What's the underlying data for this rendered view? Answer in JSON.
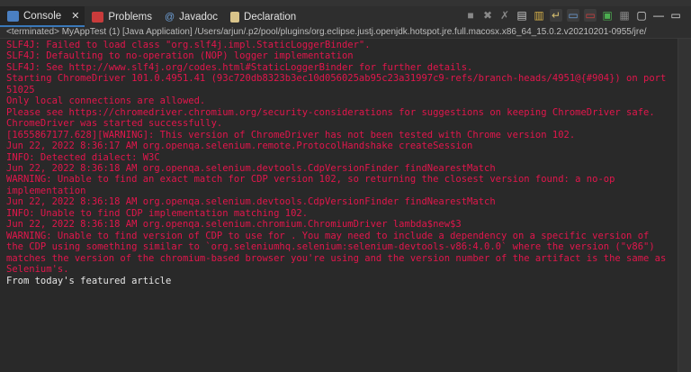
{
  "tabs": [
    {
      "label": "Console",
      "active": true,
      "icon": "console-icon"
    },
    {
      "label": "Problems",
      "icon": "problems-icon"
    },
    {
      "label": "Javadoc",
      "icon": "javadoc-icon"
    },
    {
      "label": "Declaration",
      "icon": "declaration-icon"
    }
  ],
  "toolbar": [
    "terminate-icon",
    "remove-launch-icon",
    "remove-all-icon",
    "clear-console-icon",
    "scroll-lock-icon",
    "word-wrap-icon",
    "show-on-stdout-icon",
    "show-on-stderr-icon",
    "pin-console-icon",
    "display-console-icon",
    "open-console-icon",
    "minimize-icon",
    "maximize-icon"
  ],
  "status": "<terminated> MyAppTest (1) [Java Application] /Users/arjun/.p2/pool/plugins/org.eclipse.justj.openjdk.hotspot.jre.full.macosx.x86_64_15.0.2.v20210201-0955/jre/",
  "colors": {
    "stderr": "#e2164c",
    "stdout": "#e6e6e6",
    "background": "#292929"
  },
  "lines": [
    "SLF4J: Failed to load class \"org.slf4j.impl.StaticLoggerBinder\".",
    "SLF4J: Defaulting to no-operation (NOP) logger implementation",
    "SLF4J: See http://www.slf4j.org/codes.html#StaticLoggerBinder for further details.",
    "Starting ChromeDriver 101.0.4951.41 (93c720db8323b3ec10d056025ab95c23a31997c9-refs/branch-heads/4951@{#904}) on port",
    "51025",
    "Only local connections are allowed.",
    "Please see https://chromedriver.chromium.org/security-considerations for suggestions on keeping ChromeDriver safe.",
    "ChromeDriver was started successfully.",
    "[1655867177.628][WARNING]: This version of ChromeDriver has not been tested with Chrome version 102.",
    "Jun 22, 2022 8:36:17 AM org.openqa.selenium.remote.ProtocolHandshake createSession",
    "INFO: Detected dialect: W3C",
    "Jun 22, 2022 8:36:18 AM org.openqa.selenium.devtools.CdpVersionFinder findNearestMatch",
    "WARNING: Unable to find an exact match for CDP version 102, so returning the closest version found: a no-op",
    "implementation",
    "Jun 22, 2022 8:36:18 AM org.openqa.selenium.devtools.CdpVersionFinder findNearestMatch",
    "INFO: Unable to find CDP implementation matching 102.",
    "Jun 22, 2022 8:36:18 AM org.openqa.selenium.chromium.ChromiumDriver lambda$new$3",
    "WARNING: Unable to find version of CDP to use for . You may need to include a dependency on a specific version of",
    "the CDP using something similar to `org.seleniumhq.selenium:selenium-devtools-v86:4.0.0` where the version (\"v86\")",
    "matches the version of the chromium-based browser you're using and the version number of the artifact is the same as",
    "Selenium's."
  ],
  "stdout_lines": [
    "From today's featured article"
  ]
}
